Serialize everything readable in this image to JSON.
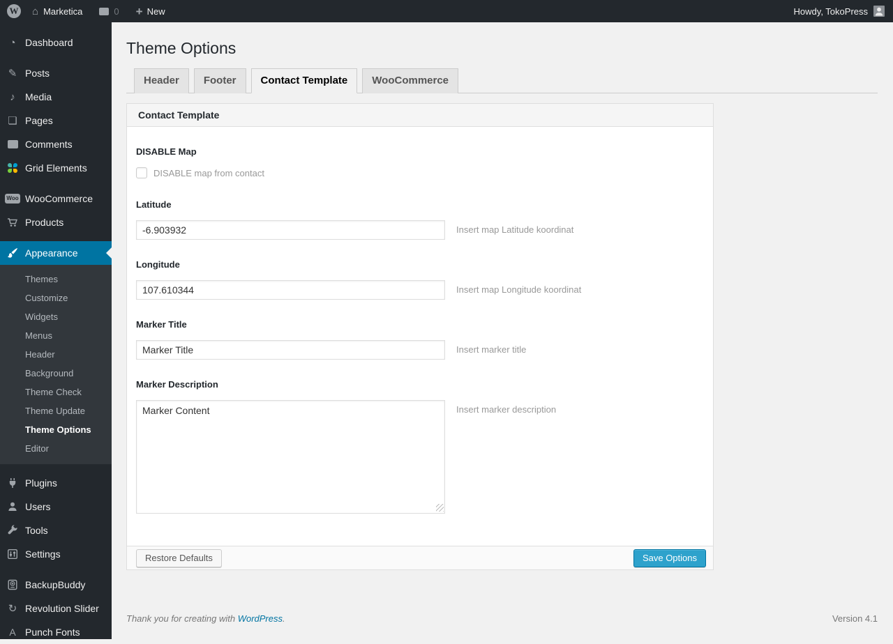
{
  "colors": {
    "adminbar_bg": "#23282d",
    "sidebar_bg": "#23282d",
    "submenu_bg": "#32373c",
    "menu_highlight": "#0074a2",
    "content_bg": "#f1f1f1",
    "button_primary_bg": "#2ea2cc",
    "button_primary_border": "#0074a2",
    "link_color": "#0074a2"
  },
  "icons": {
    "wp_logo": "W",
    "home": "⌂",
    "plus": "+",
    "dashboard": "◔",
    "posts": "✎",
    "media": "♪",
    "pages": "❏",
    "woo": "Woo",
    "revolution_slider": "↻",
    "punch_fonts": "A"
  },
  "admin_bar": {
    "site_name": "Marketica",
    "comment_count": "0",
    "new_label": "New",
    "howdy_text": "Howdy, TokoPress"
  },
  "sidebar": {
    "items": [
      {
        "label": "Dashboard"
      },
      {
        "label": "Posts"
      },
      {
        "label": "Media"
      },
      {
        "label": "Pages"
      },
      {
        "label": "Comments"
      },
      {
        "label": "Grid Elements"
      },
      {
        "label": "WooCommerce"
      },
      {
        "label": "Products"
      },
      {
        "label": "Appearance",
        "active": true
      },
      {
        "label": "Plugins"
      },
      {
        "label": "Users"
      },
      {
        "label": "Tools"
      },
      {
        "label": "Settings"
      },
      {
        "label": "BackupBuddy"
      },
      {
        "label": "Revolution Slider"
      },
      {
        "label": "Punch Fonts"
      }
    ],
    "appearance_submenu": [
      {
        "label": "Themes"
      },
      {
        "label": "Customize"
      },
      {
        "label": "Widgets"
      },
      {
        "label": "Menus"
      },
      {
        "label": "Header"
      },
      {
        "label": "Background"
      },
      {
        "label": "Theme Check"
      },
      {
        "label": "Theme Update"
      },
      {
        "label": "Theme Options",
        "active": true
      },
      {
        "label": "Editor"
      }
    ]
  },
  "main": {
    "page_title": "Theme Options",
    "tabs": [
      {
        "label": "Header"
      },
      {
        "label": "Footer"
      },
      {
        "label": "Contact Template",
        "active": true
      },
      {
        "label": "WooCommerce"
      }
    ],
    "panel": {
      "title": "Contact Template",
      "disable_map": {
        "label": "DISABLE Map",
        "checkbox_label": "DISABLE map from contact",
        "checked": false
      },
      "latitude": {
        "label": "Latitude",
        "value": "-6.903932",
        "hint": "Insert map Latitude koordinat"
      },
      "longitude": {
        "label": "Longitude",
        "value": "107.610344",
        "hint": "Insert map Longitude koordinat"
      },
      "marker_title": {
        "label": "Marker Title",
        "value": "Marker Title",
        "hint": "Insert marker title"
      },
      "marker_description": {
        "label": "Marker Description",
        "value": "Marker Content",
        "hint": "Insert marker description"
      },
      "restore_label": "Restore Defaults",
      "save_label": "Save Options"
    }
  },
  "footer": {
    "thanks_prefix": "Thank you for creating with ",
    "wordpress_link": "WordPress",
    "thanks_suffix": ".",
    "version": "Version 4.1"
  }
}
